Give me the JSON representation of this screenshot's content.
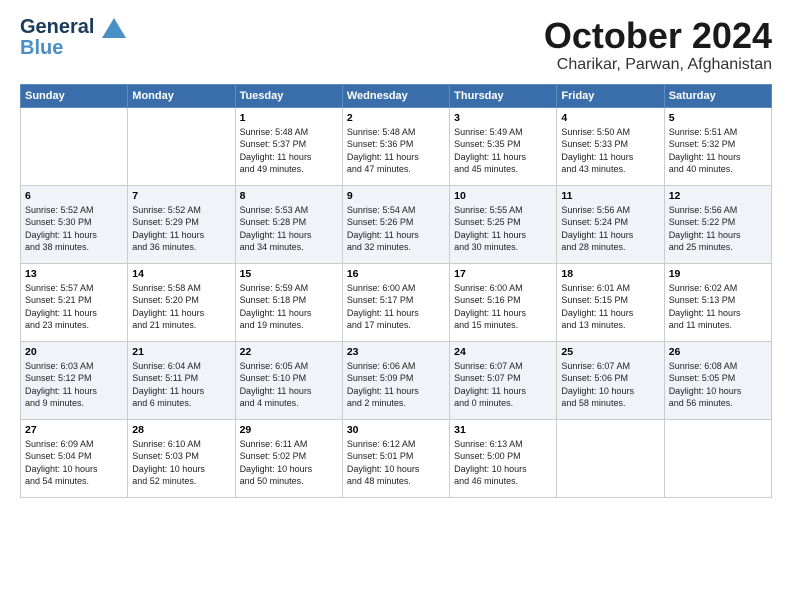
{
  "logo": {
    "line1": "General",
    "line2": "Blue"
  },
  "header": {
    "month": "October 2024",
    "location": "Charikar, Parwan, Afghanistan"
  },
  "days_of_week": [
    "Sunday",
    "Monday",
    "Tuesday",
    "Wednesday",
    "Thursday",
    "Friday",
    "Saturday"
  ],
  "weeks": [
    [
      {
        "day": "",
        "info": ""
      },
      {
        "day": "",
        "info": ""
      },
      {
        "day": "1",
        "info": "Sunrise: 5:48 AM\nSunset: 5:37 PM\nDaylight: 11 hours\nand 49 minutes."
      },
      {
        "day": "2",
        "info": "Sunrise: 5:48 AM\nSunset: 5:36 PM\nDaylight: 11 hours\nand 47 minutes."
      },
      {
        "day": "3",
        "info": "Sunrise: 5:49 AM\nSunset: 5:35 PM\nDaylight: 11 hours\nand 45 minutes."
      },
      {
        "day": "4",
        "info": "Sunrise: 5:50 AM\nSunset: 5:33 PM\nDaylight: 11 hours\nand 43 minutes."
      },
      {
        "day": "5",
        "info": "Sunrise: 5:51 AM\nSunset: 5:32 PM\nDaylight: 11 hours\nand 40 minutes."
      }
    ],
    [
      {
        "day": "6",
        "info": "Sunrise: 5:52 AM\nSunset: 5:30 PM\nDaylight: 11 hours\nand 38 minutes."
      },
      {
        "day": "7",
        "info": "Sunrise: 5:52 AM\nSunset: 5:29 PM\nDaylight: 11 hours\nand 36 minutes."
      },
      {
        "day": "8",
        "info": "Sunrise: 5:53 AM\nSunset: 5:28 PM\nDaylight: 11 hours\nand 34 minutes."
      },
      {
        "day": "9",
        "info": "Sunrise: 5:54 AM\nSunset: 5:26 PM\nDaylight: 11 hours\nand 32 minutes."
      },
      {
        "day": "10",
        "info": "Sunrise: 5:55 AM\nSunset: 5:25 PM\nDaylight: 11 hours\nand 30 minutes."
      },
      {
        "day": "11",
        "info": "Sunrise: 5:56 AM\nSunset: 5:24 PM\nDaylight: 11 hours\nand 28 minutes."
      },
      {
        "day": "12",
        "info": "Sunrise: 5:56 AM\nSunset: 5:22 PM\nDaylight: 11 hours\nand 25 minutes."
      }
    ],
    [
      {
        "day": "13",
        "info": "Sunrise: 5:57 AM\nSunset: 5:21 PM\nDaylight: 11 hours\nand 23 minutes."
      },
      {
        "day": "14",
        "info": "Sunrise: 5:58 AM\nSunset: 5:20 PM\nDaylight: 11 hours\nand 21 minutes."
      },
      {
        "day": "15",
        "info": "Sunrise: 5:59 AM\nSunset: 5:18 PM\nDaylight: 11 hours\nand 19 minutes."
      },
      {
        "day": "16",
        "info": "Sunrise: 6:00 AM\nSunset: 5:17 PM\nDaylight: 11 hours\nand 17 minutes."
      },
      {
        "day": "17",
        "info": "Sunrise: 6:00 AM\nSunset: 5:16 PM\nDaylight: 11 hours\nand 15 minutes."
      },
      {
        "day": "18",
        "info": "Sunrise: 6:01 AM\nSunset: 5:15 PM\nDaylight: 11 hours\nand 13 minutes."
      },
      {
        "day": "19",
        "info": "Sunrise: 6:02 AM\nSunset: 5:13 PM\nDaylight: 11 hours\nand 11 minutes."
      }
    ],
    [
      {
        "day": "20",
        "info": "Sunrise: 6:03 AM\nSunset: 5:12 PM\nDaylight: 11 hours\nand 9 minutes."
      },
      {
        "day": "21",
        "info": "Sunrise: 6:04 AM\nSunset: 5:11 PM\nDaylight: 11 hours\nand 6 minutes."
      },
      {
        "day": "22",
        "info": "Sunrise: 6:05 AM\nSunset: 5:10 PM\nDaylight: 11 hours\nand 4 minutes."
      },
      {
        "day": "23",
        "info": "Sunrise: 6:06 AM\nSunset: 5:09 PM\nDaylight: 11 hours\nand 2 minutes."
      },
      {
        "day": "24",
        "info": "Sunrise: 6:07 AM\nSunset: 5:07 PM\nDaylight: 11 hours\nand 0 minutes."
      },
      {
        "day": "25",
        "info": "Sunrise: 6:07 AM\nSunset: 5:06 PM\nDaylight: 10 hours\nand 58 minutes."
      },
      {
        "day": "26",
        "info": "Sunrise: 6:08 AM\nSunset: 5:05 PM\nDaylight: 10 hours\nand 56 minutes."
      }
    ],
    [
      {
        "day": "27",
        "info": "Sunrise: 6:09 AM\nSunset: 5:04 PM\nDaylight: 10 hours\nand 54 minutes."
      },
      {
        "day": "28",
        "info": "Sunrise: 6:10 AM\nSunset: 5:03 PM\nDaylight: 10 hours\nand 52 minutes."
      },
      {
        "day": "29",
        "info": "Sunrise: 6:11 AM\nSunset: 5:02 PM\nDaylight: 10 hours\nand 50 minutes."
      },
      {
        "day": "30",
        "info": "Sunrise: 6:12 AM\nSunset: 5:01 PM\nDaylight: 10 hours\nand 48 minutes."
      },
      {
        "day": "31",
        "info": "Sunrise: 6:13 AM\nSunset: 5:00 PM\nDaylight: 10 hours\nand 46 minutes."
      },
      {
        "day": "",
        "info": ""
      },
      {
        "day": "",
        "info": ""
      }
    ]
  ]
}
